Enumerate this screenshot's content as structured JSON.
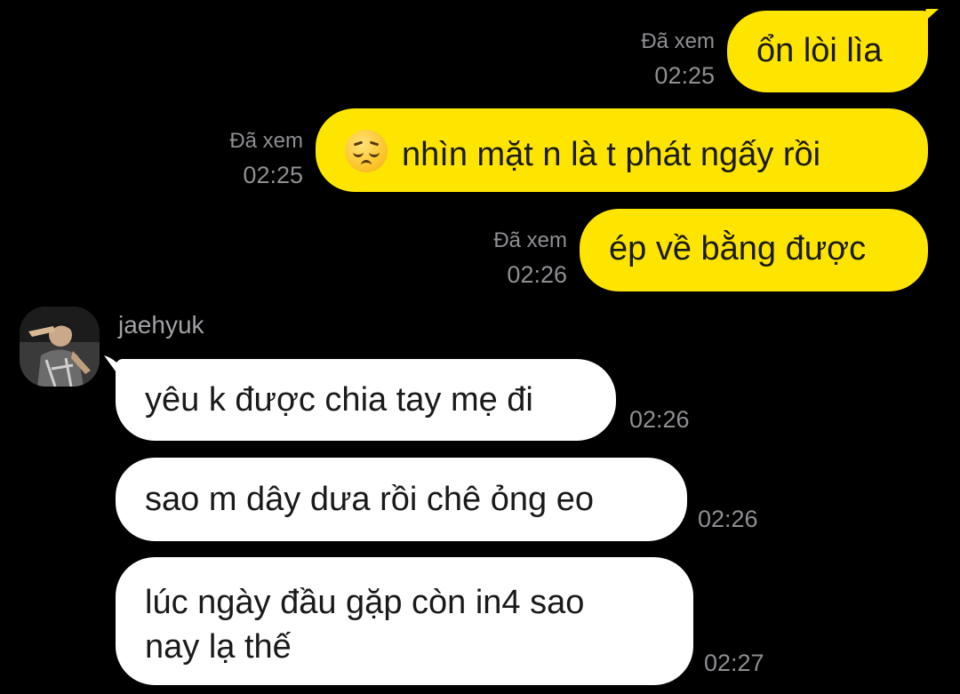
{
  "conversation": {
    "sent_messages": [
      {
        "text": "ổn lòi lìa",
        "seen_label": "Đã xem",
        "time": "02:25"
      },
      {
        "text": "nhìn mặt n là t phát ngấy rồi",
        "emoji": "pensive-face-emoji",
        "seen_label": "Đã xem",
        "time": "02:25"
      },
      {
        "text": "ép về bằng được",
        "seen_label": "Đã xem",
        "time": "02:26"
      }
    ],
    "contact": {
      "name": "jaehyuk",
      "avatar": "avatar-photo"
    },
    "received_messages": [
      {
        "text": "yêu k được chia tay mẹ đi",
        "time": "02:26"
      },
      {
        "text": "sao m dây dưa rồi chê ỏng eo",
        "time": "02:26"
      },
      {
        "lines": [
          "lúc ngày đầu gặp còn in4 sao",
          "nay lạ thế"
        ],
        "time": "02:27"
      }
    ]
  },
  "colors": {
    "background": "#000000",
    "sent_bubble": "#FEE500",
    "received_bubble": "#FFFFFF",
    "meta_text": "#8e8e93"
  }
}
